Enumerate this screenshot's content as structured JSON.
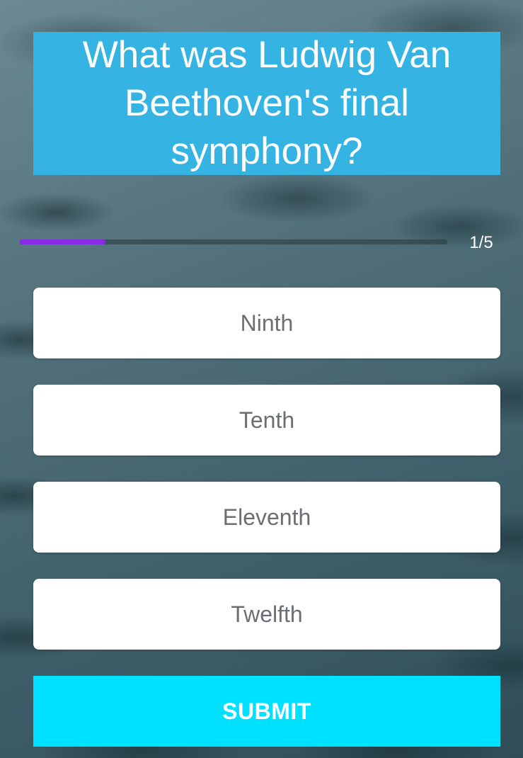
{
  "question": {
    "text": "What was Ludwig Van Beethoven's final symphony?"
  },
  "progress": {
    "current": 1,
    "total": 5,
    "counter_text": "1/5",
    "fill_color": "#8a2be2"
  },
  "options": [
    {
      "label": "Ninth"
    },
    {
      "label": "Tenth"
    },
    {
      "label": "Eleventh"
    },
    {
      "label": "Twelfth"
    }
  ],
  "submit": {
    "label": "SUBMIT"
  },
  "colors": {
    "question_bg": "#35b4e4",
    "submit_bg": "#00e0ff",
    "option_bg": "#ffffff",
    "option_text": "#6b6f73"
  }
}
